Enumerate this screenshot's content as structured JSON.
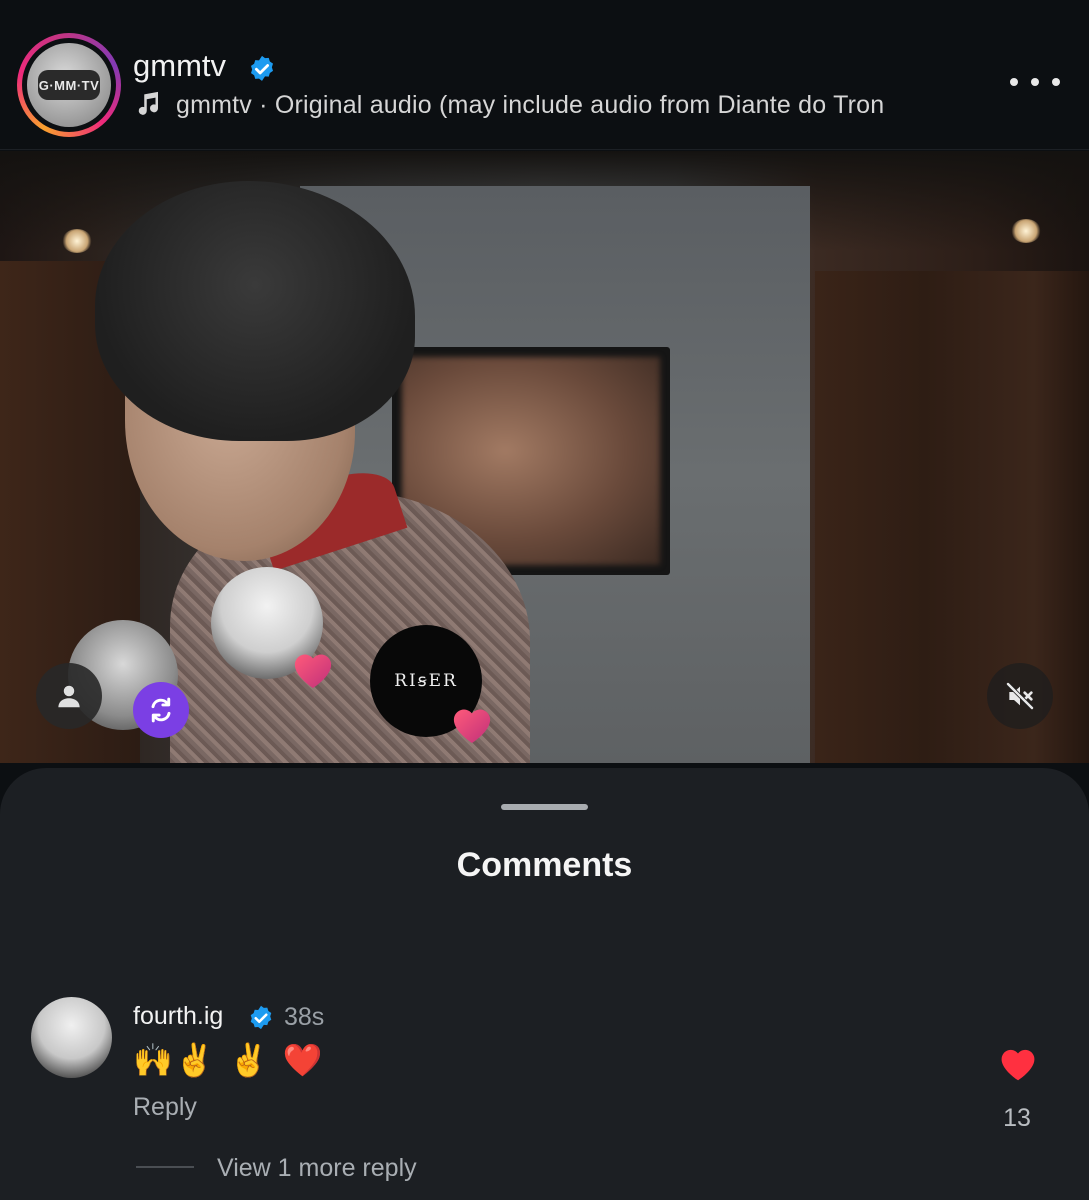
{
  "post": {
    "username": "gmmtv",
    "audio_text": "gmmtv · Original audio  (may include audio from Diante do Tron",
    "logo_text": "G·MM·TV"
  },
  "video": {
    "overlay_brand": "RIꞩER",
    "muted": true
  },
  "comments": {
    "title": "Comments",
    "items": [
      {
        "username": "fourth.ig",
        "time": "38s",
        "text": "🙌✌️ ✌️ ❤️",
        "reply_label": "Reply",
        "likes": "13",
        "view_more_label": "View 1 more reply"
      }
    ]
  },
  "colors": {
    "verified": "#1d9bf0",
    "like": "#ff3040",
    "repost": "#7b3fe4",
    "sheet_bg": "#1c1f23"
  },
  "icons": [
    "verified-badge-icon",
    "music-note-icon",
    "more-icon",
    "profile-icon",
    "repost-icon",
    "heart-icon",
    "muted-speaker-icon"
  ]
}
